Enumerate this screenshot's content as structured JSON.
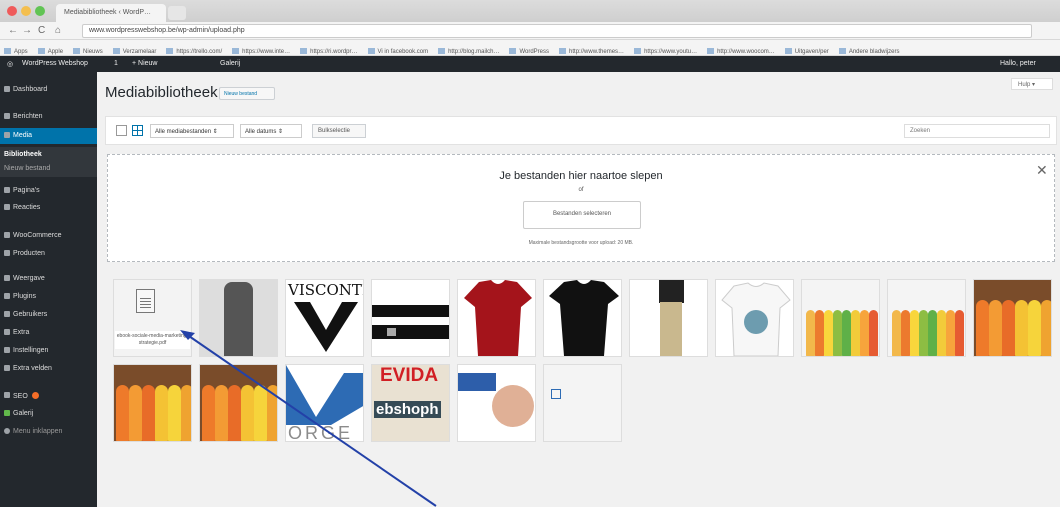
{
  "browser": {
    "tab_title": "Mediabibliotheek ‹ WordP…",
    "url": "www.wordpresswebshop.be/wp-admin/upload.php",
    "bookmarks": [
      "Apps",
      "Apple",
      "Nieuws",
      "Verzamelaar",
      "https://trello.com/",
      "https://www.inte…",
      "https://ri.wordpr…",
      "Vi in facebook.com",
      "http://blog.mailch…",
      "WordPress",
      "http://www.themes…",
      "https://www.youtu…",
      "http://www.woocom…",
      "Uitgaven/per",
      "Andere bladwijzers"
    ]
  },
  "adminbar": {
    "site": "WordPress Webshop",
    "comments": "1",
    "new": "+ Nieuw",
    "gallery": "Galerij",
    "user": "Hallo, peter"
  },
  "sidebar": {
    "items": [
      {
        "label": "Dashboard",
        "icon": "dashboard-icon"
      },
      {
        "label": "Berichten",
        "icon": "pin-icon"
      },
      {
        "label": "Media",
        "icon": "media-icon"
      },
      {
        "label": "Bibliotheek",
        "icon": ""
      },
      {
        "label": "Nieuw bestand",
        "icon": ""
      },
      {
        "label": "Pagina's",
        "icon": "page-icon"
      },
      {
        "label": "Reacties",
        "icon": "comments-icon"
      },
      {
        "label": "WooCommerce",
        "icon": "woocommerce-icon"
      },
      {
        "label": "Producten",
        "icon": "products-icon"
      },
      {
        "label": "Weergave",
        "icon": "appearance-icon"
      },
      {
        "label": "Plugins",
        "icon": "plugins-icon"
      },
      {
        "label": "Gebruikers",
        "icon": "users-icon"
      },
      {
        "label": "Extra",
        "icon": "tools-icon"
      },
      {
        "label": "Instellingen",
        "icon": "settings-icon"
      },
      {
        "label": "Extra velden",
        "icon": "custom-fields-icon"
      },
      {
        "label": "SEO",
        "icon": "seo-icon"
      },
      {
        "label": "Galerij",
        "icon": "gallery-icon"
      },
      {
        "label": "Menu inklappen",
        "icon": "collapse-icon"
      }
    ]
  },
  "main": {
    "title": "Mediabibliotheek",
    "add_new": "Nieuw bestand",
    "help": "Hulp ▾",
    "filter_type": "Alle mediabestanden ⇕",
    "filter_date": "Alle datums ⇕",
    "bulk": "Bulkselectie",
    "search_placeholder": "Zoeken"
  },
  "dropzone": {
    "title": "Je bestanden hier naartoe slepen",
    "or": "of",
    "button": "Bestanden selecteren",
    "max": "Maximale bestandsgrootte voor upload: 20 MB."
  },
  "media": {
    "document_title": "ebook-sociale-media-marketing-strategie.pdf",
    "logo_visconti": "VISCONTI",
    "logo_evida": "EVIDA",
    "logo_webshop": "ebshoph",
    "logo_orge": "ORGE"
  },
  "colors": {
    "wp_blue": "#0073aa",
    "sidebar_dark": "#23282d",
    "arrow": "#2341a8"
  }
}
